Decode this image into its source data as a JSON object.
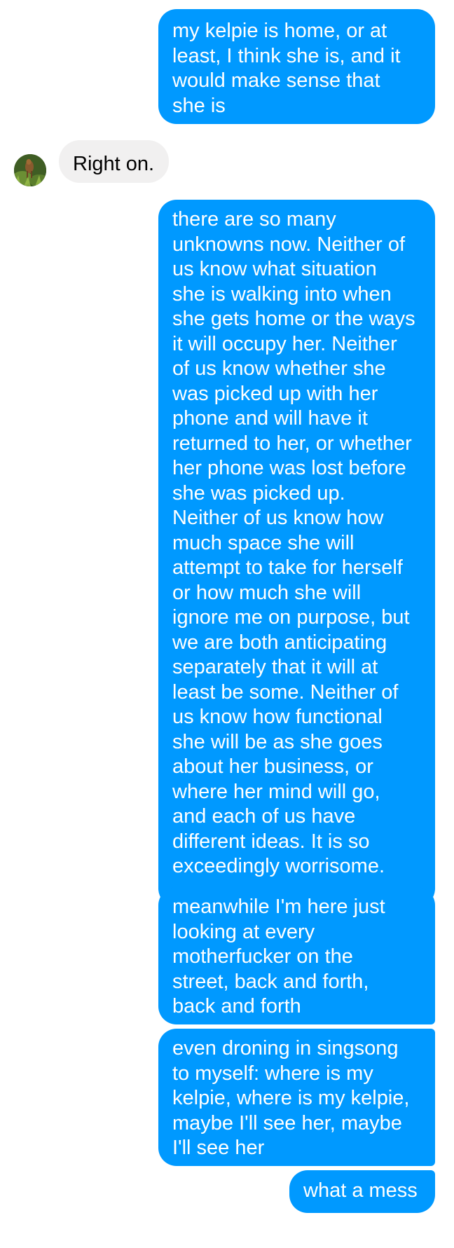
{
  "conversation": {
    "messages": [
      {
        "sender": "self",
        "text": "my kelpie is home, or at\nleast, I think she is, and it\nwould make sense that\nshe is"
      },
      {
        "sender": "other",
        "text": "Right on."
      },
      {
        "sender": "self",
        "text": "there are so many\nunknowns now. Neither of\nus know what situation\nshe is walking into when\nshe gets home or the ways\nit will occupy her. Neither\nof us know whether she\nwas picked up with her\nphone and will have it\nreturned to her, or whether\nher phone was lost before\nshe was picked up.\nNeither of us know how\nmuch space she will\nattempt to take for herself\nor how much she will\nignore me on purpose, but\nwe are both anticipating\nseparately that it will at\nleast be some. Neither of\nus know how functional\nshe will be as she goes\nabout her business, or\nwhere her mind will go,\nand each of us have\ndifferent ideas. It is so\nexceedingly worrisome."
      },
      {
        "sender": "self",
        "text": "meanwhile I'm here just\nlooking at every\nmotherfucker on the\nstreet, back and forth,\nback and forth"
      },
      {
        "sender": "self",
        "text": "even droning in singsong\nto myself: where is my\nkelpie, where is my kelpie,\nmaybe I'll see her, maybe\nI'll see her"
      },
      {
        "sender": "self",
        "text": "what a mess"
      }
    ]
  },
  "theme": {
    "outgoing_color": "#0099ff",
    "incoming_color": "#f1f0f0"
  },
  "icons": {
    "avatar": "contact-avatar-photo"
  }
}
